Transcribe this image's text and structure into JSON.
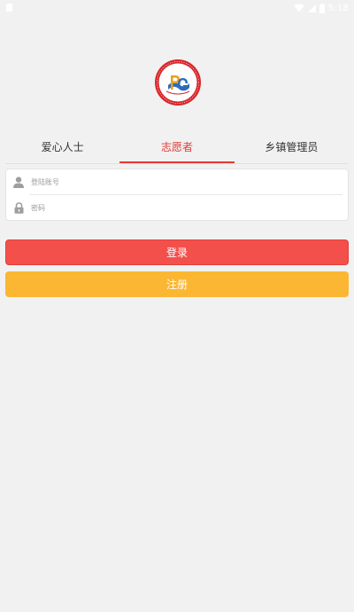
{
  "status_bar": {
    "time": "5:18",
    "icons": [
      "sim-icon",
      "wifi-icon",
      "signal-icon",
      "battery-icon"
    ]
  },
  "logo": {
    "name": "organization-logo-icon"
  },
  "tabs": [
    {
      "label": "爱心人士",
      "active": false
    },
    {
      "label": "志愿者",
      "active": true
    },
    {
      "label": "乡镇管理员",
      "active": false
    }
  ],
  "form": {
    "account_placeholder": "登陆账号",
    "account_value": "",
    "password_placeholder": "密码",
    "password_value": ""
  },
  "buttons": {
    "login_label": "登录",
    "register_label": "注册"
  },
  "colors": {
    "accent_red": "#e53935",
    "login_button": "#f3504c",
    "register_button": "#fbb733",
    "background": "#f1f1f1"
  }
}
